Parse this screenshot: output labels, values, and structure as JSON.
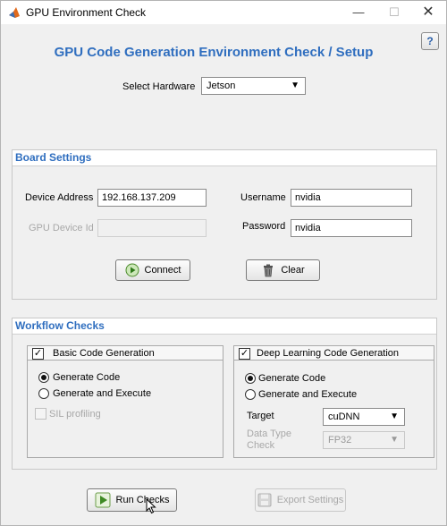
{
  "window": {
    "title": "GPU Environment Check",
    "minimize": "—",
    "maximize": "☐",
    "close": "✕",
    "help": "?"
  },
  "header": {
    "title": "GPU Code Generation Environment Check / Setup",
    "hardware_label": "Select Hardware",
    "hardware_value": "Jetson"
  },
  "board": {
    "title": "Board Settings",
    "device_address_label": "Device Address",
    "device_address_value": "192.168.137.209",
    "gpu_device_id_label": "GPU Device Id",
    "gpu_device_id_value": "",
    "username_label": "Username",
    "username_value": "nvidia",
    "password_label": "Password",
    "password_value": "nvidia",
    "connect_label": "Connect",
    "clear_label": "Clear"
  },
  "workflow": {
    "title": "Workflow Checks",
    "basic": {
      "label": "Basic Code Generation",
      "checked": true,
      "generate_code": "Generate Code",
      "generate_execute": "Generate and Execute",
      "selected": "Generate Code",
      "sil_label": "SIL profiling"
    },
    "deep": {
      "label": "Deep Learning Code Generation",
      "checked": true,
      "generate_code": "Generate Code",
      "generate_execute": "Generate and Execute",
      "selected": "Generate Code",
      "target_label": "Target",
      "target_value": "cuDNN",
      "data_type_label_1": "Data Type",
      "data_type_label_2": "Check",
      "data_type_value": "FP32"
    }
  },
  "footer": {
    "run_label": "Run Checks",
    "export_label": "Export Settings"
  }
}
